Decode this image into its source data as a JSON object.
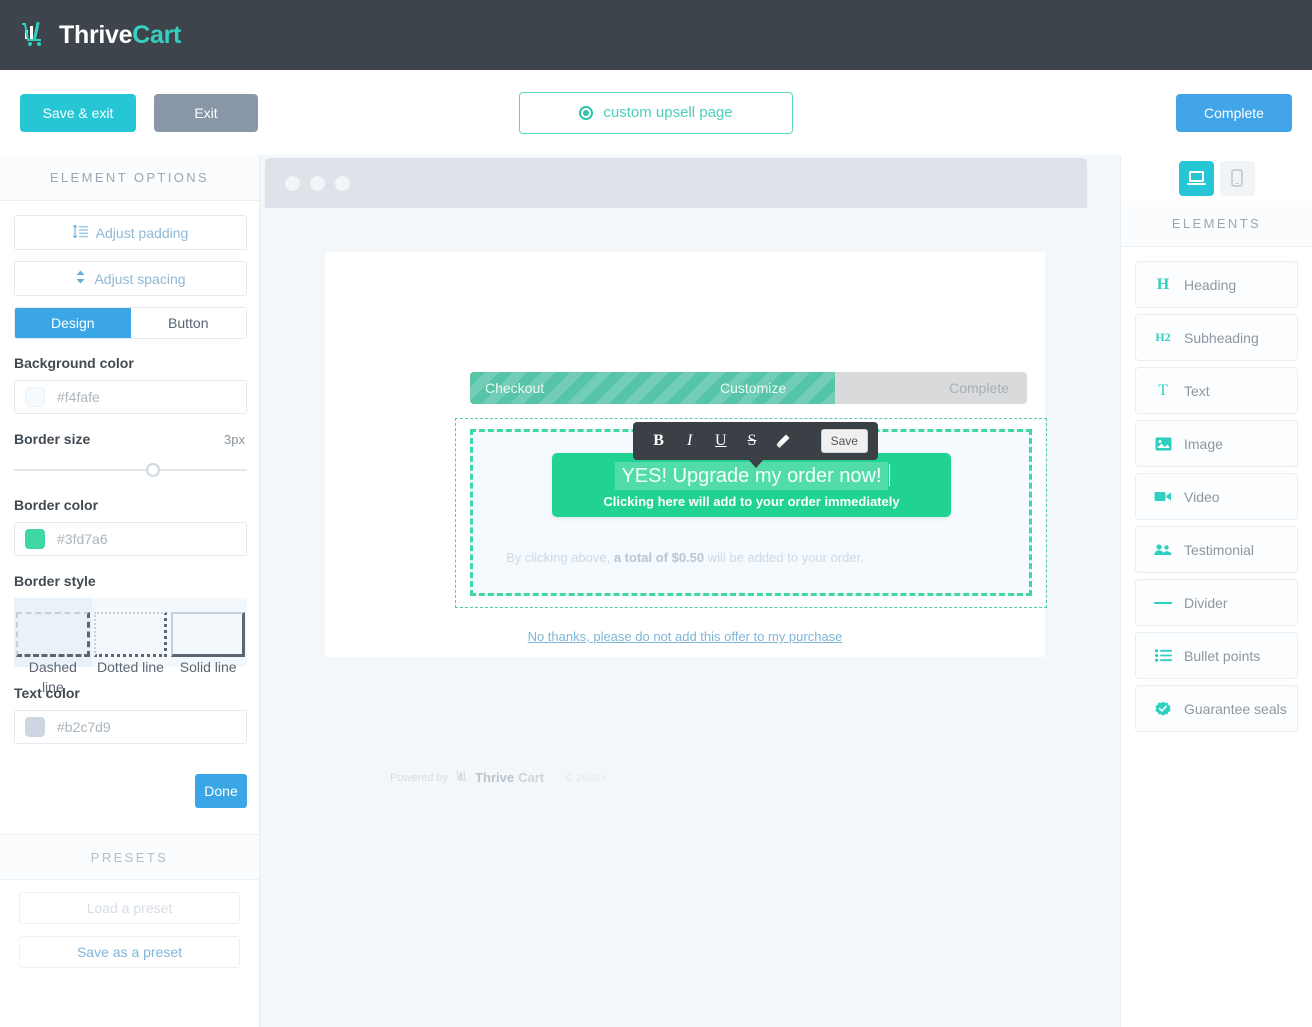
{
  "brand": {
    "name_1": "Thrive",
    "name_2": "Cart",
    "logo_icon": "cart-chart-logo"
  },
  "actionbar": {
    "save_exit": "Save & exit",
    "exit": "Exit",
    "complete": "Complete",
    "page_pill": "custom upsell page",
    "page_pill_icon": "radio-selected-icon"
  },
  "left_panel": {
    "title": "ELEMENT OPTIONS",
    "adjust_padding": "Adjust padding",
    "adjust_padding_icon": "padding-lines-icon",
    "adjust_spacing": "Adjust spacing",
    "adjust_spacing_icon": "up-down-arrows-icon",
    "tab_design": "Design",
    "tab_button": "Button",
    "background_color_label": "Background color",
    "background_color_value": "#f4fafe",
    "border_size_label": "Border size",
    "border_size_value": "3px",
    "border_color_label": "Border color",
    "border_color_value": "#3fd7a6",
    "border_style_label": "Border style",
    "border_styles": [
      {
        "label": "Dashed line",
        "icon": "dashed-corner-icon",
        "selected": true
      },
      {
        "label": "Dotted line",
        "icon": "dotted-corner-icon",
        "selected": false
      },
      {
        "label": "Solid line",
        "icon": "solid-corner-icon",
        "selected": false
      }
    ],
    "text_color_label": "Text color",
    "text_color_value": "#b2c7d9",
    "done": "Done",
    "presets_title": "PRESETS",
    "load_preset": "Load a preset",
    "save_preset": "Save as a preset"
  },
  "canvas": {
    "progress": {
      "step_1": "Checkout",
      "step_2": "Customize",
      "step_3": "Complete",
      "fill_percent": 65
    },
    "format_toolbar": {
      "bold": "B",
      "italic": "I",
      "underline": "U",
      "strikethrough": "S",
      "highlighter_icon": "highlighter-pen-icon",
      "save": "Save"
    },
    "cta_headline": "YES! Upgrade my order now!",
    "cta_subtext": "Clicking here will add to your order immediately",
    "fineprint_pre": "By clicking above, ",
    "fineprint_bold": "a total of $0.50",
    "fineprint_post": " will be added to your order.",
    "decline_link": "No thanks, please do not add this offer to my purchase",
    "footer_powered": "Powered by",
    "footer_brand_1": "Thrive",
    "footer_brand_2": "Cart",
    "footer_copyright": "© 2020+"
  },
  "right_panel": {
    "device_desktop_icon": "desktop-monitor-icon",
    "device_mobile_icon": "mobile-phone-icon",
    "title": "ELEMENTS",
    "items": [
      {
        "label": "Heading",
        "icon": "heading-h-icon"
      },
      {
        "label": "Subheading",
        "icon": "subheading-h2-icon"
      },
      {
        "label": "Text",
        "icon": "text-t-icon"
      },
      {
        "label": "Image",
        "icon": "image-picture-icon"
      },
      {
        "label": "Video",
        "icon": "video-camera-icon"
      },
      {
        "label": "Testimonial",
        "icon": "people-group-icon"
      },
      {
        "label": "Divider",
        "icon": "horizontal-line-icon"
      },
      {
        "label": "Bullet points",
        "icon": "bullet-list-icon"
      },
      {
        "label": "Guarantee seals",
        "icon": "check-badge-icon"
      }
    ]
  },
  "colors": {
    "brand_dark": "#3e444c",
    "teal": "#26c6d4",
    "blue": "#41a5e8",
    "green": "#21d393",
    "mint": "#3fd7a6"
  }
}
